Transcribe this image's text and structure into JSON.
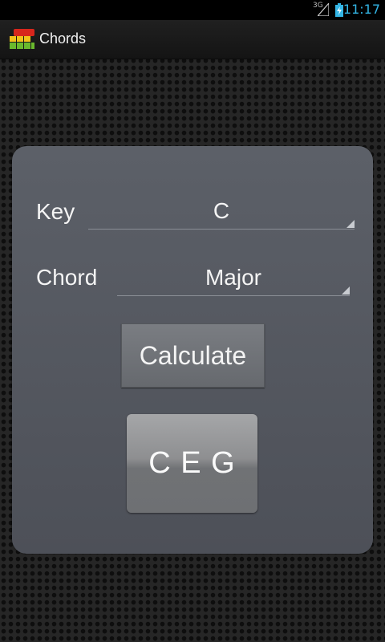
{
  "status_bar": {
    "network": "3G",
    "time": "11:17"
  },
  "action_bar": {
    "title": "Chords",
    "app_icon": "chords-app-icon"
  },
  "form": {
    "key_label": "Key",
    "key_value": "C",
    "chord_label": "Chord",
    "chord_value": "Major",
    "calculate_label": "Calculate",
    "result": "C E G"
  },
  "colors": {
    "accent": "#33b5e5",
    "panel": "#54575f",
    "background": "#262626"
  }
}
